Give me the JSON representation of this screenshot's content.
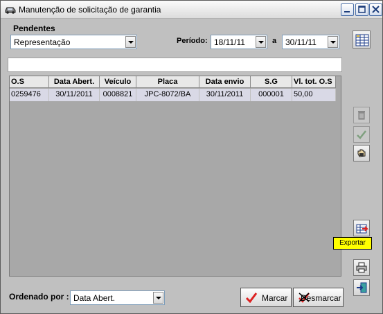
{
  "window": {
    "title": "Manutenção de solicitação de garantia"
  },
  "pendentes": {
    "label": "Pendentes",
    "value": "Representação"
  },
  "periodo": {
    "label": "Período:",
    "start": "18/11/11",
    "separator": "a",
    "end": "30/11/11"
  },
  "grid": {
    "columns": [
      "O.S",
      "Data Abert.",
      "Veículo",
      "Placa",
      "Data envio",
      "S.G",
      "Vl. tot. O.S"
    ],
    "rows": [
      [
        "0259476",
        "30/11/2011",
        "0008821",
        "JPC-8072/BA",
        "30/11/2011",
        "000001",
        "50,00"
      ]
    ]
  },
  "tooltip": {
    "text": "Exportar"
  },
  "ordenado": {
    "label": "Ordenado por :",
    "value": "Data Abert."
  },
  "buttons": {
    "marcar": "Marcar",
    "desmarcar": "Desmarcar"
  },
  "icons": {
    "title": "car-icon",
    "side": [
      "grid-settings-icon",
      "trash-icon",
      "check-icon",
      "hand-icon",
      "export-icon",
      "printer-icon",
      "exit-door-icon"
    ]
  }
}
